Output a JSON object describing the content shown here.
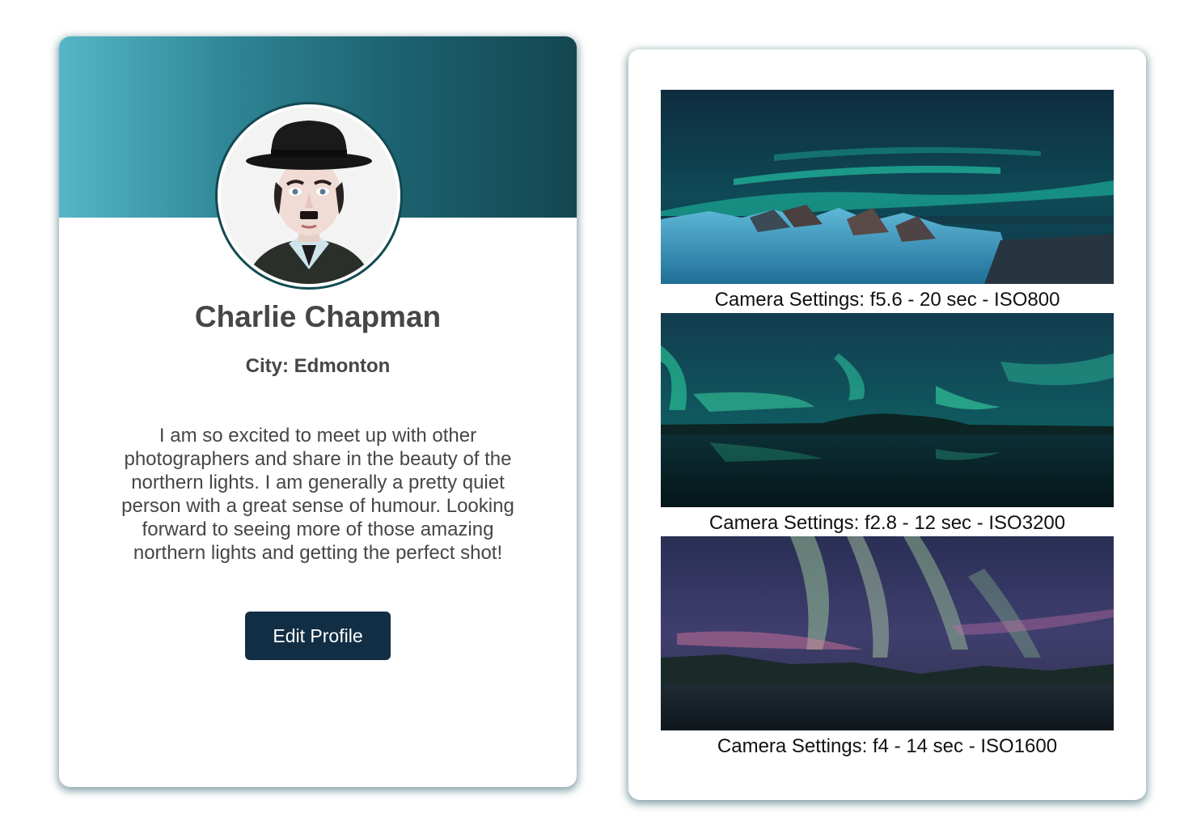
{
  "profile": {
    "name": "Charlie Chapman",
    "city": "City: Edmonton",
    "bio": "I am so excited to meet up with other photographers and share in the beauty of the northern lights. I am generally a pretty quiet person with a great sense of humour. Looking forward to seeing more of those amazing northern lights and getting the perfect shot!",
    "edit_button_label": "Edit Profile",
    "colors": {
      "banner_light": "#55b6c8",
      "banner_dark": "#134650",
      "button_bg": "#122e45",
      "text": "#464646"
    }
  },
  "gallery": {
    "photos": [
      {
        "caption": "Camera Settings: f5.6 - 20 sec - ISO800"
      },
      {
        "caption": "Camera Settings: f2.8 - 12 sec - ISO3200"
      },
      {
        "caption": "Camera Settings: f4 - 14 sec - ISO1600"
      }
    ]
  }
}
